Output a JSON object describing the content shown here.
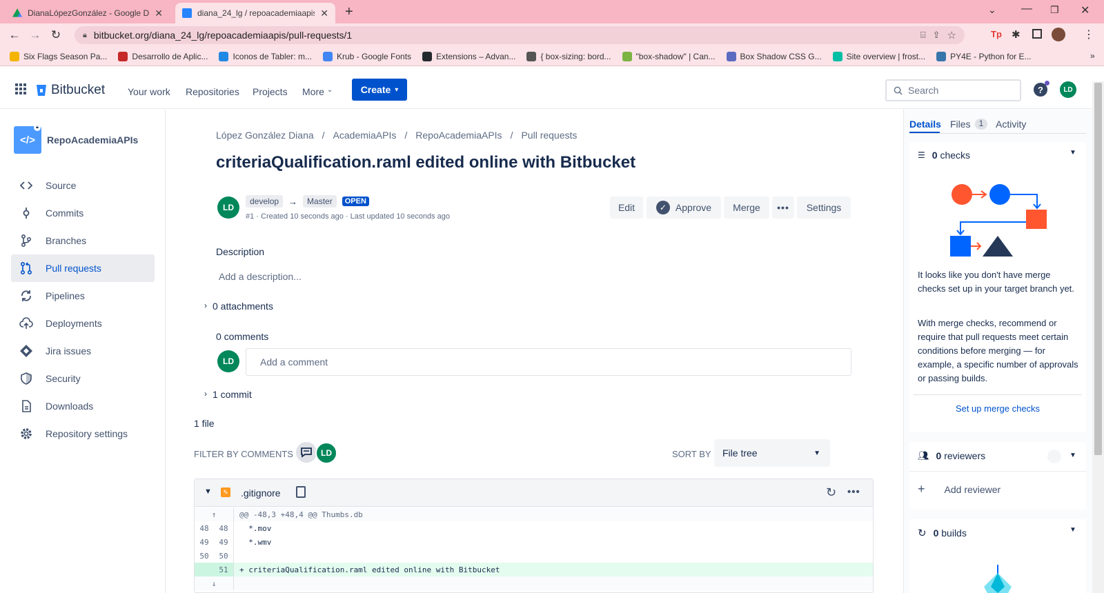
{
  "browser": {
    "tabs": [
      {
        "title": "DianaLópezGonzález - Google Dr",
        "favicon_color": "#f4b400"
      },
      {
        "title": "diana_24_lg / repoacademiaapis",
        "favicon_color": "#2684ff"
      }
    ],
    "url": "bitbucket.org/diana_24_lg/repoacademiaapis/pull-requests/1",
    "bookmarks": [
      {
        "label": "Six Flags Season Pa...",
        "color": "#f4b400"
      },
      {
        "label": "Desarrollo de Aplic...",
        "color": "#c62828"
      },
      {
        "label": "Iconos de Tabler: m...",
        "color": "#1e88e5"
      },
      {
        "label": "Krub - Google Fonts",
        "color": "#4285f4"
      },
      {
        "label": "Extensions – Advan...",
        "color": "#24292e"
      },
      {
        "label": "{ box-sizing: bord...",
        "color": "#555555"
      },
      {
        "label": "\"box-shadow\" | Can...",
        "color": "#7cb342"
      },
      {
        "label": "Box Shadow CSS G...",
        "color": "#5c6bc0"
      },
      {
        "label": "Site overview | frost...",
        "color": "#00bfa5"
      },
      {
        "label": "PY4E - Python for E...",
        "color": "#3776ab"
      }
    ]
  },
  "header": {
    "brand": "Bitbucket",
    "nav": [
      "Your work",
      "Repositories",
      "Projects",
      "More"
    ],
    "create": "Create",
    "search_placeholder": "Search",
    "avatar": "LD"
  },
  "sidebar": {
    "repo_name": "RepoAcademiaAPIs",
    "items": [
      {
        "label": "Source",
        "icon": "code-icon"
      },
      {
        "label": "Commits",
        "icon": "commit-icon"
      },
      {
        "label": "Branches",
        "icon": "branch-icon"
      },
      {
        "label": "Pull requests",
        "icon": "pull-request-icon"
      },
      {
        "label": "Pipelines",
        "icon": "pipelines-icon"
      },
      {
        "label": "Deployments",
        "icon": "cloud-upload-icon"
      },
      {
        "label": "Jira issues",
        "icon": "jira-icon"
      },
      {
        "label": "Security",
        "icon": "shield-icon"
      },
      {
        "label": "Downloads",
        "icon": "document-icon"
      },
      {
        "label": "Repository settings",
        "icon": "gear-icon"
      }
    ],
    "selected": "Pull requests"
  },
  "main": {
    "breadcrumb": [
      "López González Diana",
      "AcademiaAPIs",
      "RepoAcademiaAPIs",
      "Pull requests"
    ],
    "title": "criteriaQualification.raml edited online with Bitbucket",
    "author_avatar": "LD",
    "source_branch": "develop",
    "target_branch": "Master",
    "status": "OPEN",
    "meta": "#1 · Created 10 seconds ago · Last updated 10 seconds ago",
    "actions": {
      "edit": "Edit",
      "approve": "Approve",
      "merge": "Merge",
      "more": "•••",
      "settings": "Settings"
    },
    "description_heading": "Description",
    "description_placeholder": "Add a description...",
    "attachments": "0 attachments",
    "comments_heading": "0 comments",
    "comment_placeholder": "Add a comment",
    "commits": "1 commit",
    "files_count": "1 file",
    "filter_label": "FILTER BY COMMENTS",
    "filter_avatar": "LD",
    "sort_label": "SORT BY",
    "sort_value": "File tree",
    "diff": {
      "filename": ".gitignore",
      "hunk": "@@ -48,3 +48,4 @@ Thumbs.db",
      "lines": [
        {
          "old": "48",
          "new": "48",
          "text": "  *.mov",
          "added": false
        },
        {
          "old": "49",
          "new": "49",
          "text": "  *.wmv",
          "added": false
        },
        {
          "old": "50",
          "new": "50",
          "text": "",
          "added": false
        },
        {
          "old": "",
          "new": "51",
          "text": "+ criteriaQualification.raml edited online with Bitbucket",
          "added": true
        }
      ]
    }
  },
  "right_panel": {
    "tabs": [
      "Details",
      "Files",
      "Activity"
    ],
    "files_badge": "1",
    "checks": {
      "count": "0",
      "label": "checks"
    },
    "checks_text_1": "It looks like you don't have merge checks set up in your target branch yet.",
    "checks_text_2": "With merge checks, recommend or require that pull requests meet certain conditions before merging — for example, a specific number of approvals or passing builds.",
    "setup_link": "Set up merge checks",
    "reviewers": {
      "count": "0",
      "label": "reviewers"
    },
    "add_reviewer": "Add reviewer",
    "builds": {
      "count": "0",
      "label": "builds"
    }
  },
  "colors": {
    "brand": "#0052cc",
    "avatar": "#00875a",
    "added_line": "#e3fcef",
    "illustration_red": "#ff5630",
    "illustration_blue": "#0065ff",
    "illustration_navy": "#253858"
  }
}
